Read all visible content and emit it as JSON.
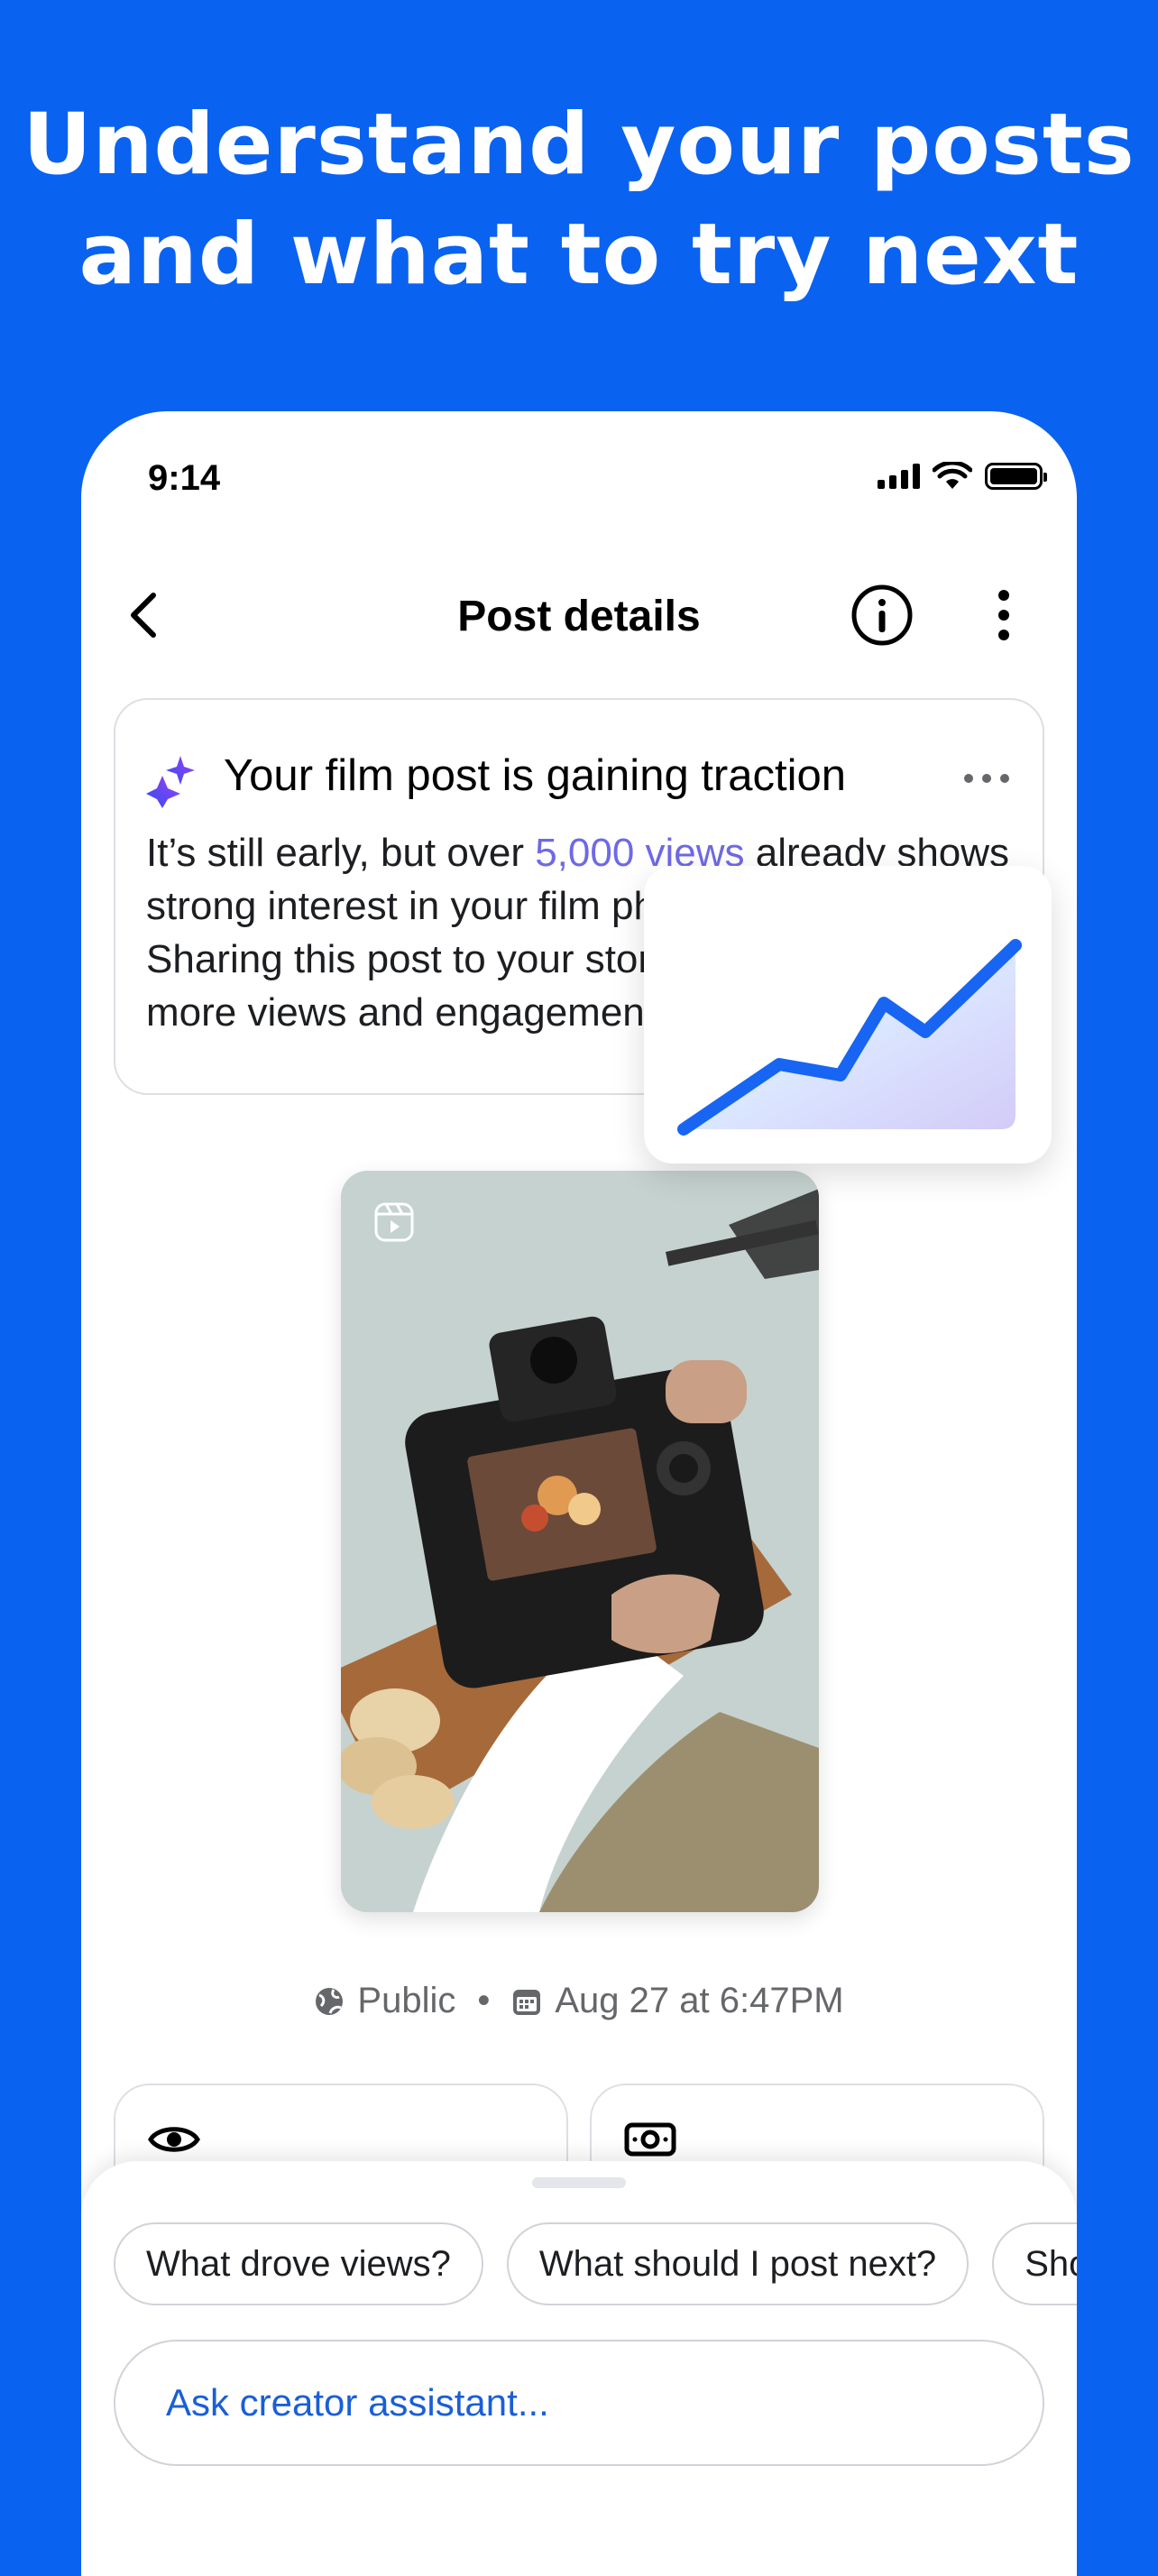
{
  "headline": {
    "line1": "Understand your posts",
    "line2": "and what to try next"
  },
  "status_bar": {
    "time": "9:14"
  },
  "header": {
    "title": "Post details"
  },
  "insight": {
    "title": "Your film post is gaining traction",
    "body_before": "It’s still early, but over ",
    "body_highlight": "5,000 views",
    "body_after": " already shows strong interest in your film photography journey. Sharing this post to your story could help attract more views and engagement."
  },
  "post_meta": {
    "visibility": "Public",
    "separator": "•",
    "date": "Aug 27 at 6:47PM"
  },
  "assistant": {
    "chips": [
      "What drove views?",
      "What should I post next?",
      "Sho"
    ],
    "input_placeholder": "Ask creator assistant..."
  },
  "colors": {
    "brand": "#0a62f1",
    "highlight": "#6e69e6",
    "chart_line": "#1765f2"
  },
  "icons": [
    "back-icon",
    "info-icon",
    "more-vertical-icon",
    "sparkle-icon",
    "more-horizontal-icon",
    "reel-icon",
    "globe-icon",
    "calendar-icon",
    "eye-icon",
    "money-icon",
    "trend-chart-icon"
  ]
}
